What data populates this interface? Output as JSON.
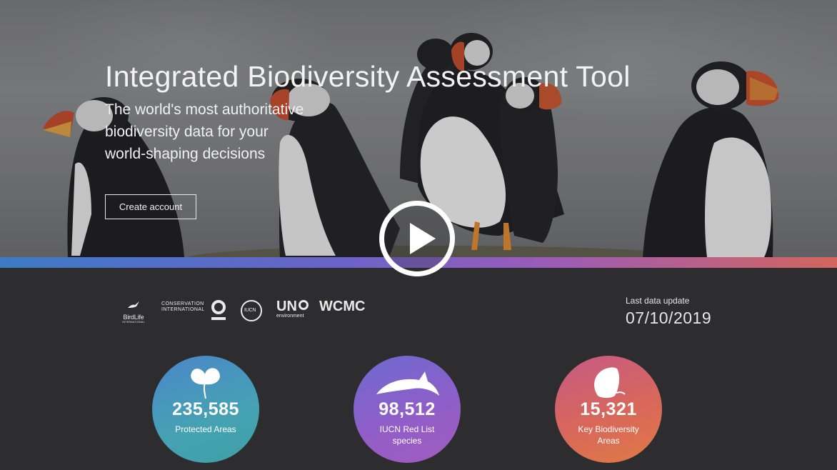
{
  "hero": {
    "title": "Integrated Biodiversity Assessment Tool",
    "subtitle": "The world's most authoritative biodiversity data for your world-shaping decisions",
    "create_account_label": "Create account"
  },
  "partners": {
    "birdlife": "BirdLife",
    "birdlife_sub": "INTERNATIONAL",
    "conservation_line1": "CONSERVATION",
    "conservation_line2": "INTERNATIONAL",
    "iucn": "IUCN",
    "un": "UN",
    "un_sub": "environment",
    "wcmc": "WCMC"
  },
  "update": {
    "label": "Last data update",
    "date": "07/10/2019"
  },
  "stats": [
    {
      "value": "235,585",
      "label": "Protected Areas",
      "icon": "flower-icon"
    },
    {
      "value": "98,512",
      "label": "IUCN Red List species",
      "icon": "dolphin-icon"
    },
    {
      "value": "15,321",
      "label": "Key Biodiversity Areas",
      "icon": "butterfly-icon"
    }
  ],
  "colors": {
    "background": "#2d2d2f",
    "bar_start": "#3d7bc4",
    "bar_mid": "#9a5cb9",
    "bar_end": "#d3655d",
    "stat_protected": "#46a2b3",
    "stat_redlist": "#8f5ec8",
    "stat_kba": "#d8675a"
  }
}
